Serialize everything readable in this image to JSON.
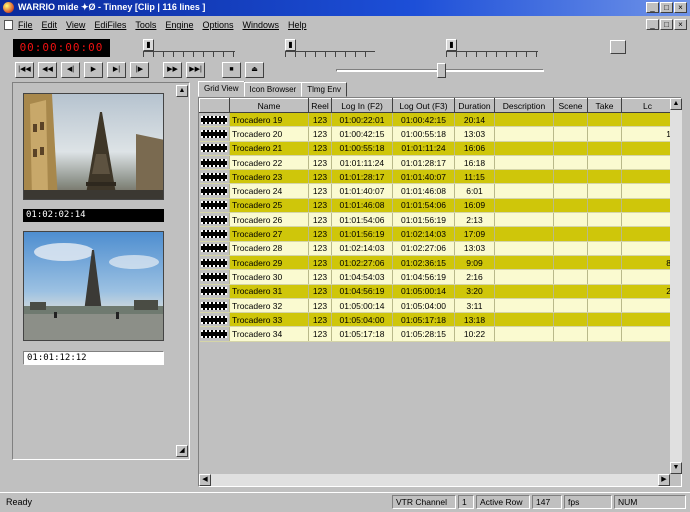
{
  "window": {
    "title": "WARRIO mide   ✦Ø - Tinney   [Clip | 116 lines ]",
    "controls": [
      "_",
      "□",
      "×"
    ]
  },
  "menu": [
    "File",
    "Edit",
    "View",
    "EdiFiles",
    "Tools",
    "Engine",
    "Options",
    "Windows",
    "Help"
  ],
  "toolbar": {
    "timecode": "00:00:00:00",
    "transport": [
      "|◀◀",
      "◀◀",
      "◀|",
      "▶",
      "▶|",
      "|▶",
      "▶▶",
      "▶▶|",
      "■",
      "⏏"
    ]
  },
  "left_panel": {
    "tc_display": "01:02:02:14",
    "tc_field": "01:01:12:12"
  },
  "tabs": [
    "Grid View",
    "Icon Browser",
    "Tlmg Env"
  ],
  "table": {
    "headers": [
      "",
      "Name",
      "Reel",
      "Log In (F2)",
      "Log Out (F3)",
      "Duration",
      "Description",
      "Scene",
      "Take",
      "Lc"
    ],
    "rows": [
      [
        "Trocadero 19",
        "123",
        "01:00:22:01",
        "01:00:42:15",
        "20:14",
        "",
        "",
        "",
        ""
      ],
      [
        "Trocadero 20",
        "123",
        "01:00:42:15",
        "01:00:55:18",
        "13:03",
        "",
        "",
        "",
        "1"
      ],
      [
        "Trocadero 21",
        "123",
        "01:00:55:18",
        "01:01:11:24",
        "16:06",
        "",
        "",
        "",
        ""
      ],
      [
        "Trocadero 22",
        "123",
        "01:01:11:24",
        "01:01:28:17",
        "16:18",
        "",
        "",
        "",
        ""
      ],
      [
        "Trocadero 23",
        "123",
        "01:01:28:17",
        "01:01:40:07",
        "11:15",
        "",
        "",
        "",
        ""
      ],
      [
        "Trocadero 24",
        "123",
        "01:01:40:07",
        "01:01:46:08",
        "6:01",
        "",
        "",
        "",
        ""
      ],
      [
        "Trocadero 25",
        "123",
        "01:01:46:08",
        "01:01:54:06",
        "16:09",
        "",
        "",
        "",
        ""
      ],
      [
        "Trocadero 26",
        "123",
        "01:01:54:06",
        "01:01:56:19",
        "2:13",
        "",
        "",
        "",
        ""
      ],
      [
        "Trocadero 27",
        "123",
        "01:01:56:19",
        "01:02:14:03",
        "17:09",
        "",
        "",
        "",
        ""
      ],
      [
        "Trocadero 28",
        "123",
        "01:02:14:03",
        "01:02:27:06",
        "13:03",
        "",
        "",
        "",
        ""
      ],
      [
        "Trocadero 29",
        "123",
        "01:02:27:06",
        "01:02:36:15",
        "9:09",
        "",
        "",
        "",
        "8"
      ],
      [
        "Trocadero 30",
        "123",
        "01:04:54:03",
        "01:04:56:19",
        "2:16",
        "",
        "",
        "",
        ""
      ],
      [
        "Trocadero 31",
        "123",
        "01:04:56:19",
        "01:05:00:14",
        "3:20",
        "",
        "",
        "",
        "2"
      ],
      [
        "Trocadero 32",
        "123",
        "01:05:00:14",
        "01:05:04:00",
        "3:11",
        "",
        "",
        "",
        ""
      ],
      [
        "Trocadero 33",
        "123",
        "01:05:04:00",
        "01:05:17:18",
        "13:18",
        "",
        "",
        "",
        ""
      ],
      [
        "Trocadero 34",
        "123",
        "01:05:17:18",
        "01:05:28:15",
        "10:22",
        "",
        "",
        "",
        ""
      ]
    ]
  },
  "statusbar": {
    "ready": "Ready",
    "vtr_channel_label": "VTR Channel",
    "vtr_channel_value": "1",
    "active_row_label": "Active Row",
    "active_row_value": "147",
    "fps": "fps",
    "mode": "NUM"
  }
}
